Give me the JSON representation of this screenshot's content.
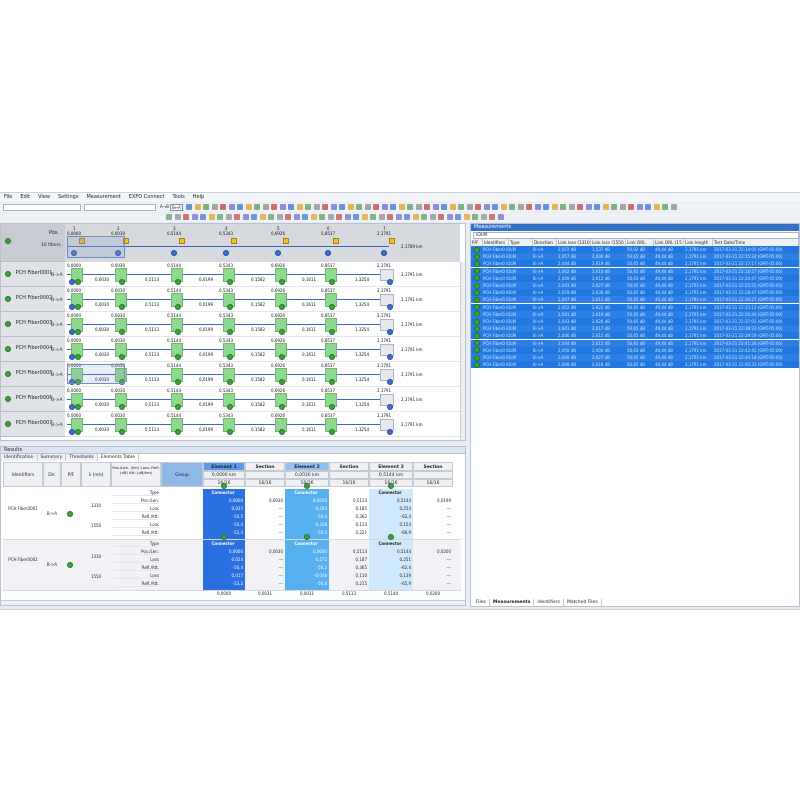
{
  "menu": [
    "File",
    "Edit",
    "View",
    "Settings",
    "Measurement",
    "EXFO Connect",
    "Tools",
    "Help"
  ],
  "toolbar": {
    "dir_btn_1": "A→B",
    "dir_btn_2": "B↔A"
  },
  "map": {
    "header": {
      "label": "Pos.",
      "fibers": "16 fibers",
      "length": "2,1789 km"
    },
    "element_numbers": [
      "1",
      "2",
      "3",
      "4",
      "5",
      "6",
      "7"
    ],
    "header_positions": [
      "0,0000",
      "0,0030",
      "0,5144",
      "0,5343",
      "0,6926",
      "0,8537",
      "2,1791"
    ],
    "rows": [
      {
        "name": "PCH Fiber0001",
        "dir": "B->A",
        "length": "2,1791 km",
        "pos": [
          "0,0000",
          "0,0030",
          "0,5144",
          "0,5343",
          "0,6926",
          "0,8537",
          "2,1791"
        ],
        "loss": [
          "0,0030",
          "0,5113",
          "0,0199",
          "0,1582",
          "0,1611",
          "1,3254"
        ]
      },
      {
        "name": "PCH Fiber0002",
        "dir": "B->A",
        "length": "2,1791 km",
        "pos": [
          "0,0000",
          "0,0030",
          "0,5144",
          "0,5343",
          "0,6926",
          "0,8537",
          "2,1791"
        ],
        "loss": [
          "0,0030",
          "0,5113",
          "0,0199",
          "0,1582",
          "0,1611",
          "1,3254"
        ]
      },
      {
        "name": "PCH Fiber0003",
        "dir": "B->A",
        "length": "2,1791 km",
        "pos": [
          "0,0000",
          "0,0030",
          "0,5144",
          "0,5343",
          "0,6926",
          "0,8537",
          "2,1791"
        ],
        "loss": [
          "0,0030",
          "0,5113",
          "0,0199",
          "0,1582",
          "0,1611",
          "1,3254"
        ]
      },
      {
        "name": "PCH Fiber0004",
        "dir": "B->A",
        "length": "2,1791 km",
        "pos": [
          "0,0000",
          "0,0030",
          "0,5144",
          "0,5343",
          "0,6926",
          "0,8537",
          "2,1791"
        ],
        "loss": [
          "0,0030",
          "0,5113",
          "0,0199",
          "0,1582",
          "0,1611",
          "1,3254"
        ]
      },
      {
        "name": "PCH Fiber0005",
        "dir": "B->A",
        "length": "2,1791 km",
        "pos": [
          "0,0000",
          "0,0030",
          "0,5144",
          "0,5343",
          "0,6926",
          "0,8537",
          "2,1791"
        ],
        "loss": [
          "0,0030",
          "0,5113",
          "0,0199",
          "0,1582",
          "0,1611",
          "1,3254"
        ]
      },
      {
        "name": "PCH Fiber0006",
        "dir": "B->A",
        "length": "2,1791 km",
        "pos": [
          "0,0000",
          "0,0030",
          "0,5144",
          "0,5343",
          "0,6926",
          "0,8537",
          "2,1791"
        ],
        "loss": [
          "0,0030",
          "0,5113",
          "0,0199",
          "0,1582",
          "0,1611",
          "1,3254"
        ]
      },
      {
        "name": "PCH Fiber0007",
        "dir": "B->A",
        "length": "2,1791 km",
        "pos": [
          "0,0000",
          "0,0030",
          "0,5144",
          "0,5343",
          "0,6926",
          "0,8537",
          "2,1791"
        ],
        "loss": [
          "0,0030",
          "0,5113",
          "0,0199",
          "0,1582",
          "0,1611",
          "1,3254"
        ]
      }
    ]
  },
  "results": {
    "title": "Results",
    "tabs": [
      "Identification",
      "Summary",
      "Thresholds",
      "Elements Table"
    ],
    "headers": {
      "identifiers": "Identifiers",
      "dir": "Dir.",
      "pf": "P/F",
      "lambda": "λ (nm)",
      "poslen": "Pos./Len. (km) Loss, Refl. (dB) Att. (dB/km)",
      "group": "Group",
      "element1": "Element 1",
      "section": "Section",
      "element2": "Element 2",
      "element3": "Element 3"
    },
    "elem_sub": {
      "e1": "0,0000 km",
      "e2": "0,0030 km",
      "e3": "0,5144 km",
      "count": "16/16",
      "sec_count": "16/16"
    },
    "fibers": [
      {
        "name": "PCH Fiber0001",
        "dir": "B->A",
        "wl": [
          "1310",
          "1550"
        ],
        "param_labels": [
          "Type",
          "Pos./Len.",
          "Loss",
          "Refl./Att.",
          "Loss",
          "Refl./Att."
        ],
        "e1": [
          "Connector",
          "0,0000",
          "0,037",
          "-50,5",
          "-50,4",
          "-52,3"
        ],
        "s1": [
          "",
          "0,0030",
          "---",
          "---",
          "---",
          "---"
        ],
        "e2": [
          "Connector",
          "0,0030",
          "0,294",
          "-50,4",
          "0,318",
          "-50,5"
        ],
        "s2": [
          "",
          "0,5113",
          "0,185",
          "0,362",
          "0,113",
          "0,221"
        ],
        "e3": [
          "Connector",
          "0,5144",
          "0,254",
          "-62,4",
          "0,154",
          "-66,9"
        ],
        "s3": [
          "",
          "0,0199",
          "---",
          "---",
          "---",
          "---"
        ]
      },
      {
        "name": "PCH Fiber0002",
        "dir": "B->A",
        "wl": [
          "1310",
          "1550"
        ],
        "param_labels": [
          "Type",
          "Pos./Len.",
          "Loss",
          "Refl./Att.",
          "Loss",
          "Refl./Att."
        ],
        "e1": [
          "Connector",
          "0,0000",
          "0,024",
          "-50,4",
          "0,017",
          "-53,2"
        ],
        "s1": [
          "",
          "0,0030",
          "---",
          "---",
          "---",
          "---"
        ],
        "e2": [
          "Connector",
          "0,0030",
          "0,272",
          "-50,2",
          "-0,036",
          "-50,8"
        ],
        "s2": [
          "",
          "0,5113",
          "0,187",
          "0,365",
          "0,110",
          "0,215"
        ],
        "e3": [
          "Connector",
          "0,5144",
          "0,251",
          "-62,4",
          "0,139",
          "-65,9"
        ],
        "s3": [
          "",
          "0,0200",
          "---",
          "---",
          "---",
          "---"
        ]
      }
    ],
    "footer_row": {
      "e1": "0,0000",
      "s1": "0,0031",
      "e2": "0,0031",
      "s2": "0,5113",
      "e3": "0,5144",
      "s3": "0,0200"
    }
  },
  "measurements": {
    "title": "Measurements",
    "filter": "iOLM",
    "columns": [
      "P/F",
      "Identifiers",
      "Type",
      "Direction",
      "Link loss (1310",
      "Link loss (1550",
      "Link ORL (13",
      "Link ORL (15",
      "Link length",
      "Test Date/Time"
    ],
    "rows": [
      {
        "id": "PCH Fiber0 iOLM",
        "dir": "B->A",
        "l1310": "2,072 dB",
        "l1550": "1,537 dB",
        "o13": "50,02 dB",
        "o15": "49,44 dB",
        "len": "2,1791 km",
        "date": "2017-03-21 22:14:05 (GMT-05:00)"
      },
      {
        "id": "PCH Fiber0 iOLM",
        "dir": "B->A",
        "l1310": "2,057 dB",
        "l1550": "2,606 dB",
        "o13": "50,65 dB",
        "o15": "49,44 dB",
        "len": "2,1791 km",
        "date": "2017-03-21 22:15:34 (GMT-05:00)"
      },
      {
        "id": "PCH Fiber0 iOLM",
        "dir": "B->A",
        "l1310": "2,044 dB",
        "l1550": "2,619 dB",
        "o13": "50,65 dB",
        "o15": "49,44 dB",
        "len": "2,1791 km",
        "date": "2017-03-21 22:17:17 (GMT-05:00)"
      },
      {
        "id": "PCH Fiber0 iOLM",
        "dir": "B->A",
        "l1310": "2,062 dB",
        "l1550": "2,610 dB",
        "o13": "50,65 dB",
        "o15": "49,44 dB",
        "len": "2,1791 km",
        "date": "2017-03-21 22:18:57 (GMT-05:00)"
      },
      {
        "id": "PCH Fiber0 iOLM",
        "dir": "B->A",
        "l1310": "2,049 dB",
        "l1550": "2,612 dB",
        "o13": "50,65 dB",
        "o15": "49,44 dB",
        "len": "2,1791 km",
        "date": "2017-03-21 22:20:47 (GMT-05:00)"
      },
      {
        "id": "PCH Fiber0 iOLM",
        "dir": "B->A",
        "l1310": "2,043 dB",
        "l1550": "2,627 dB",
        "o13": "50,65 dB",
        "o15": "49,44 dB",
        "len": "2,1791 km",
        "date": "2017-03-21 22:25:55 (GMT-05:00)"
      },
      {
        "id": "PCH Fiber0 iOLM",
        "dir": "B->A",
        "l1310": "2,029 dB",
        "l1550": "2,630 dB",
        "o13": "50,65 dB",
        "o15": "49,44 dB",
        "len": "2,1791 km",
        "date": "2017-03-21 22:28:47 (GMT-05:00)"
      },
      {
        "id": "PCH Fiber0 iOLM",
        "dir": "B->A",
        "l1310": "2,047 dB",
        "l1550": "2,611 dB",
        "o13": "50,65 dB",
        "o15": "49,44 dB",
        "len": "2,1791 km",
        "date": "2017-03-21 22:30:27 (GMT-05:00)"
      },
      {
        "id": "PCH Fiber0 iOLM",
        "dir": "B->A",
        "l1310": "2,052 dB",
        "l1550": "2,622 dB",
        "o13": "50,65 dB",
        "o15": "49,44 dB",
        "len": "2,1791 km",
        "date": "2017-03-21 22:33:12 (GMT-05:00)"
      },
      {
        "id": "PCH Fiber0 iOLM",
        "dir": "B->A",
        "l1310": "2,041 dB",
        "l1550": "2,619 dB",
        "o13": "50,65 dB",
        "o15": "49,44 dB",
        "len": "2,1791 km",
        "date": "2017-03-21 22:35:44 (GMT-05:00)"
      },
      {
        "id": "PCH Fiber0 iOLM",
        "dir": "B->A",
        "l1310": "2,043 dB",
        "l1550": "2,626 dB",
        "o13": "50,65 dB",
        "o15": "49,44 dB",
        "len": "2,1791 km",
        "date": "2017-03-21 22:37:03 (GMT-05:00)"
      },
      {
        "id": "PCH Fiber0 iOLM",
        "dir": "B->A",
        "l1310": "2,041 dB",
        "l1550": "2,617 dB",
        "o13": "50,65 dB",
        "o15": "49,44 dB",
        "len": "2,1791 km",
        "date": "2017-03-21 22:38:23 (GMT-05:00)"
      },
      {
        "id": "PCH Fiber0 iOLM",
        "dir": "B->A",
        "l1310": "2,046 dB",
        "l1550": "2,615 dB",
        "o13": "50,65 dB",
        "o15": "49,44 dB",
        "len": "2,1791 km",
        "date": "2017-03-21 22:39:59 (GMT-05:00)"
      },
      {
        "id": "PCH Fiber0 iOLM",
        "dir": "B->A",
        "l1310": "2,044 dB",
        "l1550": "2,612 dB",
        "o13": "50,65 dB",
        "o15": "49,44 dB",
        "len": "2,1791 km",
        "date": "2017-03-21 22:41:28 (GMT-05:00)"
      },
      {
        "id": "PCH Fiber0 iOLM",
        "dir": "B->A",
        "l1310": "2,050 dB",
        "l1550": "2,604 dB",
        "o13": "50,65 dB",
        "o15": "49,44 dB",
        "len": "2,1791 km",
        "date": "2017-03-21 22:42:42 (GMT-05:00)"
      },
      {
        "id": "PCH Fiber0 iOLM",
        "dir": "B->A",
        "l1310": "2,040 dB",
        "l1550": "2,627 dB",
        "o13": "50,65 dB",
        "o15": "49,44 dB",
        "len": "2,1791 km",
        "date": "2017-03-21 22:44:18 (GMT-05:00)"
      },
      {
        "id": "PCH Fiber0 iOLM",
        "dir": "B->A",
        "l1310": "2,049 dB",
        "l1550": "2,618 dB",
        "o13": "50,65 dB",
        "o15": "49,44 dB",
        "len": "2,1791 km",
        "date": "2017-03-21 22:45:33 (GMT-05:00)"
      }
    ],
    "bottom_tabs": [
      "Files",
      "Measurements",
      "Identifiers",
      "Matched Files"
    ]
  },
  "colors": {
    "selection": "#1f78e0",
    "pass": "#3aa43a",
    "element": "#8fd98f",
    "line": "#3d66c4"
  }
}
